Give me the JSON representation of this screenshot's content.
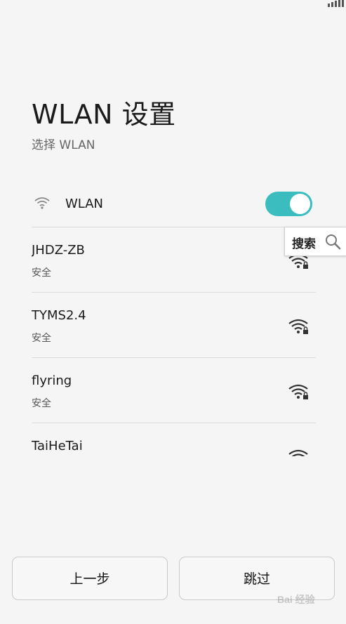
{
  "header": {
    "title": "WLAN 设置",
    "subtitle": "选择 WLAN"
  },
  "wlan_toggle": {
    "label": "WLAN",
    "state": "on",
    "accent_color": "#3bbdc0"
  },
  "networks": [
    {
      "name": "JHDZ-ZB",
      "security": "安全",
      "icon": "wifi-lock-icon"
    },
    {
      "name": "TYMS2.4",
      "security": "安全",
      "icon": "wifi-lock-icon"
    },
    {
      "name": "flyring",
      "security": "安全",
      "icon": "wifi-lock-icon"
    },
    {
      "name": "TaiHeTai",
      "security": "",
      "icon": "wifi-lock-icon"
    }
  ],
  "search": {
    "label": "搜索",
    "icon": "search-icon"
  },
  "buttons": {
    "back_label": "上一步",
    "skip_label": "跳过"
  },
  "watermark": {
    "text": "Bai 经验"
  }
}
